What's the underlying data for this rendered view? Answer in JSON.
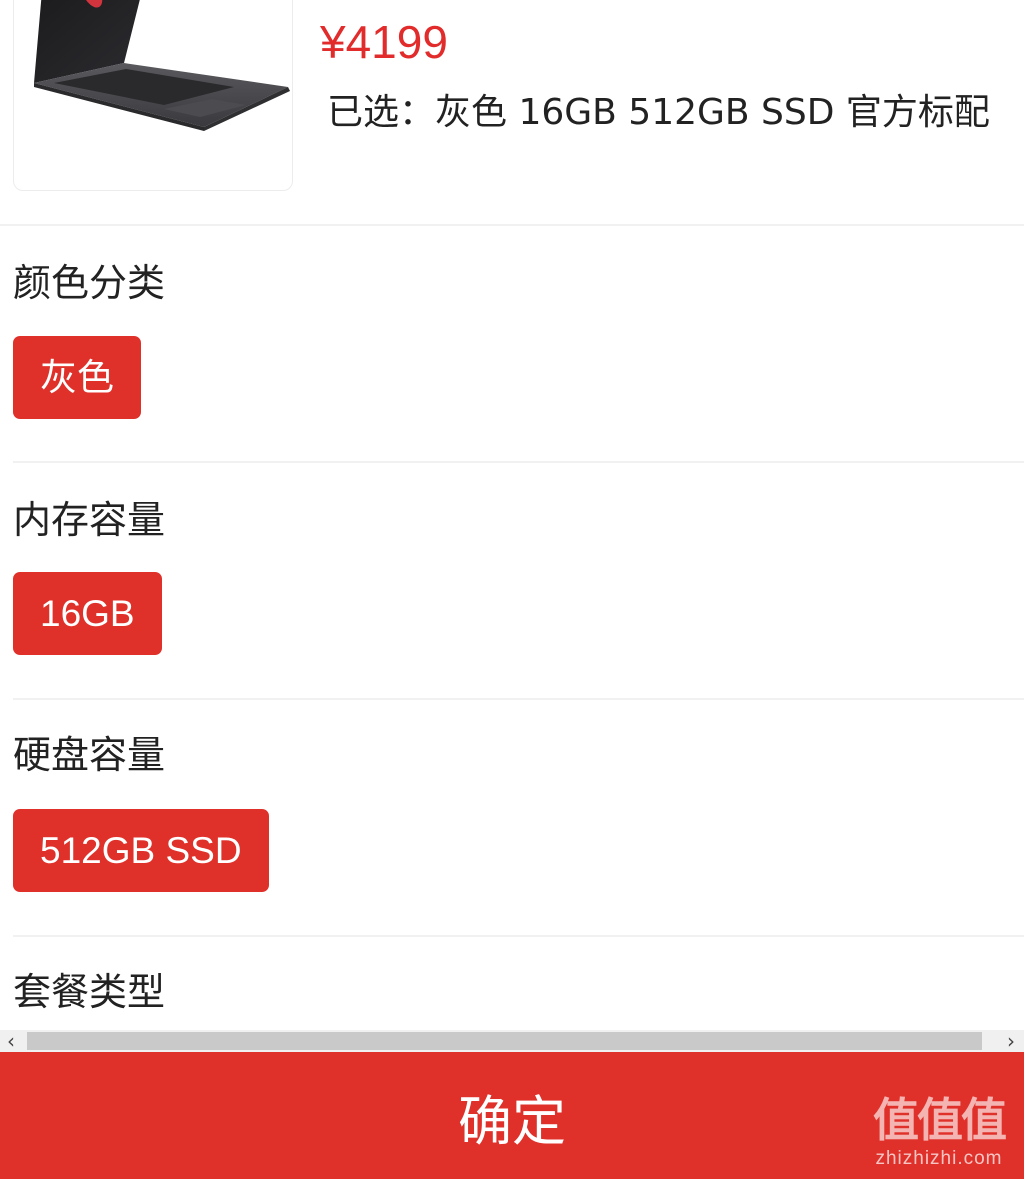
{
  "product": {
    "price": "¥4199",
    "selected_label": "已选：",
    "selected_value": "灰色 16GB 512GB SSD 官方标配"
  },
  "sections": [
    {
      "title": "颜色分类",
      "selected_option": "灰色"
    },
    {
      "title": "内存容量",
      "selected_option": "16GB"
    },
    {
      "title": "硬盘容量",
      "selected_option": "512GB SSD"
    },
    {
      "title": "套餐类型"
    }
  ],
  "confirm_label": "确定",
  "watermark": {
    "mark": "值值值",
    "url": "zhizhizhi.com"
  },
  "colors": {
    "accent": "#e0302a",
    "price": "#e22b2b"
  }
}
